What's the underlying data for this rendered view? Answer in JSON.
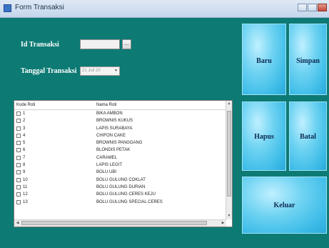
{
  "window": {
    "title": "Form Transaksi"
  },
  "form": {
    "id_label": "Id Transaksi",
    "id_value": "",
    "browse_label": "...",
    "date_label": "Tanggal Transaksi",
    "date_value": "21    Juli    20",
    "date_arrow": "▾"
  },
  "grid": {
    "columns": [
      "Kode Roti",
      "Nama Roti"
    ],
    "rows": [
      {
        "kode": "1",
        "nama": "BIKA AMBON"
      },
      {
        "kode": "2",
        "nama": "BROWNIS KUKUS"
      },
      {
        "kode": "3",
        "nama": "LAPIS SURABAYA"
      },
      {
        "kode": "4",
        "nama": "CHIFON CAKE"
      },
      {
        "kode": "5",
        "nama": "BROWNIS PANGGANG"
      },
      {
        "kode": "6",
        "nama": "BLONDIS PETAK"
      },
      {
        "kode": "7",
        "nama": "CARAMEL"
      },
      {
        "kode": "8",
        "nama": "LAPIS LEGIT"
      },
      {
        "kode": "9",
        "nama": "BOLU UBI"
      },
      {
        "kode": "10",
        "nama": "BOLU GULUNG COKLAT"
      },
      {
        "kode": "11",
        "nama": "BOLU GULUNG DURIAN"
      },
      {
        "kode": "12",
        "nama": "BOLU GULUNG CERES KEJU"
      },
      {
        "kode": "13",
        "nama": "BOLU GULUNG SPECIAL CERES"
      }
    ]
  },
  "buttons": {
    "baru": "Baru",
    "simpan": "Simpan",
    "hapus": "Hapus",
    "batal": "Batal",
    "keluar": "Keluar"
  },
  "colors": {
    "background": "#0d7a74",
    "tile": "#3fbde8",
    "tile_text": "#0b2a52"
  }
}
